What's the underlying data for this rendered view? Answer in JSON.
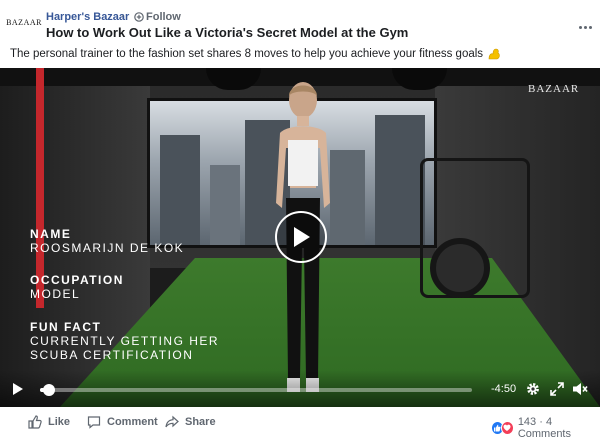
{
  "header": {
    "avatar_text": "BAZAAR",
    "page_name": "Harper's Bazaar",
    "separator": "·",
    "follow_label": "Follow",
    "title": "How to Work Out Like a Victoria's Secret Model at the Gym"
  },
  "caption": {
    "text": "The personal trainer to the fashion set shares 8 moves to help you achieve your fitness goals",
    "emoji_icon": "flexed-biceps-icon"
  },
  "video": {
    "watermark": "BAZAAR",
    "info": [
      {
        "label": "NAME",
        "value": "ROOSMARIJN DE KOK"
      },
      {
        "label": "OCCUPATION",
        "value": "MODEL"
      },
      {
        "label": "FUN FACT",
        "value": "CURRENTLY GETTING HER",
        "value2": "SCUBA CERTIFICATION"
      }
    ],
    "progress_fraction": 0.02,
    "time_remaining": "-4:50"
  },
  "footer": {
    "like_label": "Like",
    "comment_label": "Comment",
    "share_label": "Share",
    "reaction_count": "143",
    "comment_count": "4 Comments",
    "reactions_text": "143 · 4 Comments"
  },
  "colors": {
    "link_blue": "#385898",
    "like_blue": "#2078f4",
    "love_red": "#f33e58",
    "muted_gray": "#606770"
  }
}
